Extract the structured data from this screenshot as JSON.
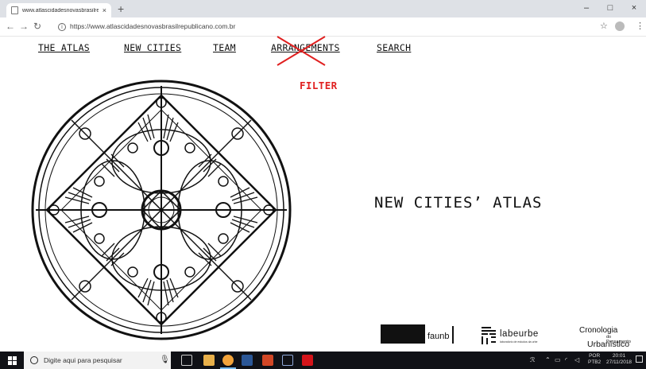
{
  "browser": {
    "tab_title": "www.atlascidadesnovasbrasilrep",
    "tab_close": "×",
    "new_tab": "+",
    "window_controls": [
      "–",
      "□",
      "×"
    ],
    "url": "https://www.atlascidadesnovasbrasilrepublicano.com.br",
    "icons": [
      "back-arrow-icon",
      "forward-arrow-icon",
      "reload-icon",
      "info-icon",
      "star-icon",
      "profile-icon",
      "menu-dots-icon"
    ]
  },
  "site_nav": {
    "items": [
      "THE ATLAS",
      "NEW CITIES",
      "TEAM",
      "ARRANGEMENTS",
      "SEARCH"
    ],
    "crossed_out": "ARRANGEMENTS"
  },
  "filter_label": "FILTER",
  "headline": "NEW CITIES’ ATLAS",
  "logos": {
    "faunb": "faunb",
    "labeurbe": "labeurbe",
    "labeurbe_sub": "laboratório de estudos da urbe",
    "cronologia_line1": "Cronologia",
    "cronologia_line2": "do Pensamento",
    "cronologia_line3": "Urbanístico"
  },
  "taskbar": {
    "search_placeholder": "Digite aqui para pesquisar",
    "language": "POR",
    "layout": "PTB2",
    "time": "20:01",
    "date": "27/11/2018"
  },
  "colors": {
    "filter_red": "#e02020",
    "taskbar": "#101116",
    "tabstrip": "#dee1e6"
  }
}
